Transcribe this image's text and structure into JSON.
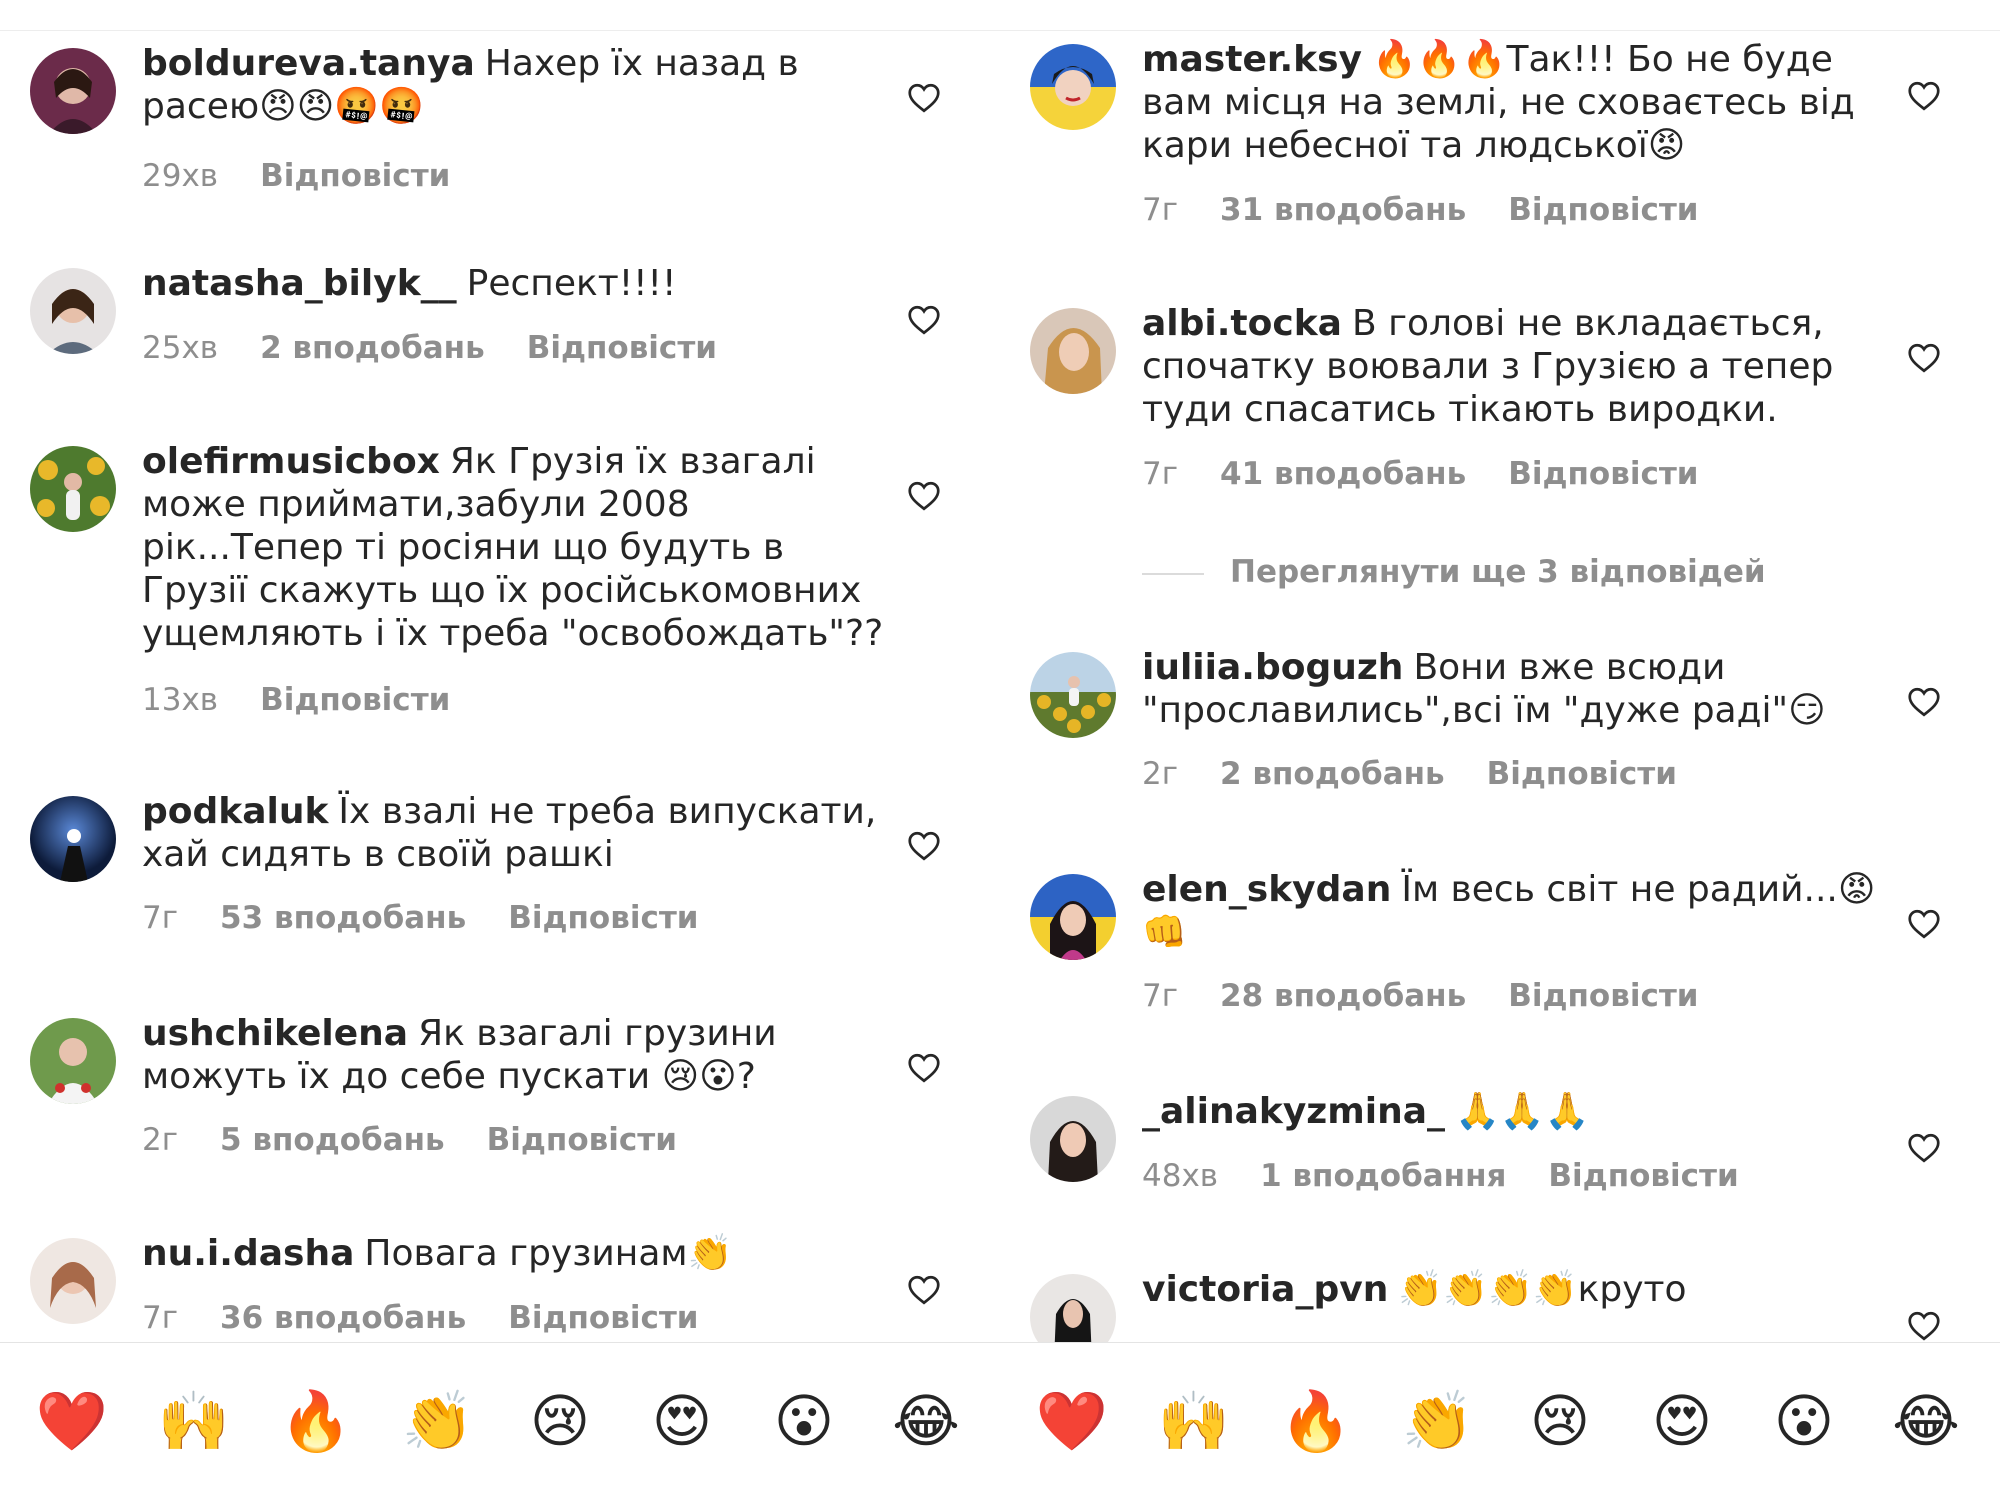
{
  "left_panel": {
    "comments": [
      {
        "username": "boldureva.tanya",
        "text": "Нахер їх назад в расею😠😠🤬🤬",
        "time": "29хв",
        "likes": "",
        "reply": "Відповісти"
      },
      {
        "username": "natasha_bilyk__",
        "text": "Респект!!!!",
        "time": "25хв",
        "likes": "2 вподобань",
        "reply": "Відповісти"
      },
      {
        "username": "olefirmusicbox",
        "text": "Як Грузія їх взагалі може приймати,забули 2008 рік...Тепер ті росіяни що будуть в Грузії скажуть що їх російськомовних ущемляють і їх треба \"освобождать\"??",
        "time": "13хв",
        "likes": "",
        "reply": "Відповісти"
      },
      {
        "username": "podkaluk",
        "text": "Їх взалі не треба випускати, хай сидять в своїй рашкі",
        "time": "7г",
        "likes": "53 вподобань",
        "reply": "Відповісти"
      },
      {
        "username": "ushchikelena",
        "text": "Як взагалі грузини можуть їх до себе пускати 😢😮?",
        "time": "2г",
        "likes": "5 вподобань",
        "reply": "Відповісти"
      },
      {
        "username": "nu.i.dasha",
        "text": "Повага грузинам👏",
        "time": "7г",
        "likes": "36 вподобань",
        "reply": "Відповісти"
      }
    ]
  },
  "right_panel": {
    "comments": [
      {
        "username": "master.ksy",
        "text": "🔥🔥🔥Так!!! Бо не буде вам місця на землі, не сховаєтесь від кари небесної та людської😡",
        "time": "7г",
        "likes": "31 вподобань",
        "reply": "Відповісти"
      },
      {
        "username": "albi.tocka",
        "text": "В голові не вкладається, спочатку воювали з Грузією а тепер туди спасатись тікають виродки.",
        "time": "7г",
        "likes": "41 вподобань",
        "reply": "Відповісти"
      },
      {
        "username": "iuliia.boguzh",
        "text": "Вони вже всюди \"прославились\",всі їм \"дуже раді\"😏",
        "time": "2г",
        "likes": "2 вподобань",
        "reply": "Відповісти"
      },
      {
        "username": "elen_skydan",
        "text": "Їм весь світ не радий...😡👊",
        "time": "7г",
        "likes": "28 вподобань",
        "reply": "Відповісти"
      },
      {
        "username": "_alinakyzmina_",
        "text": "🙏🙏🙏",
        "time": "48хв",
        "likes": "1 вподобання",
        "reply": "Відповісти"
      },
      {
        "username": "victoria_pvn",
        "text": "👏👏👏👏круто",
        "time": "",
        "likes": "",
        "reply": ""
      }
    ],
    "view_more": "Переглянути ще 3 відповідей"
  },
  "emoji_bar": [
    "❤️",
    "🙌",
    "🔥",
    "👏",
    "😢",
    "😍",
    "😮",
    "😂"
  ],
  "colors": {
    "text": "#262626",
    "muted": "#8e8e8e",
    "divider": "#dbdbdb"
  }
}
